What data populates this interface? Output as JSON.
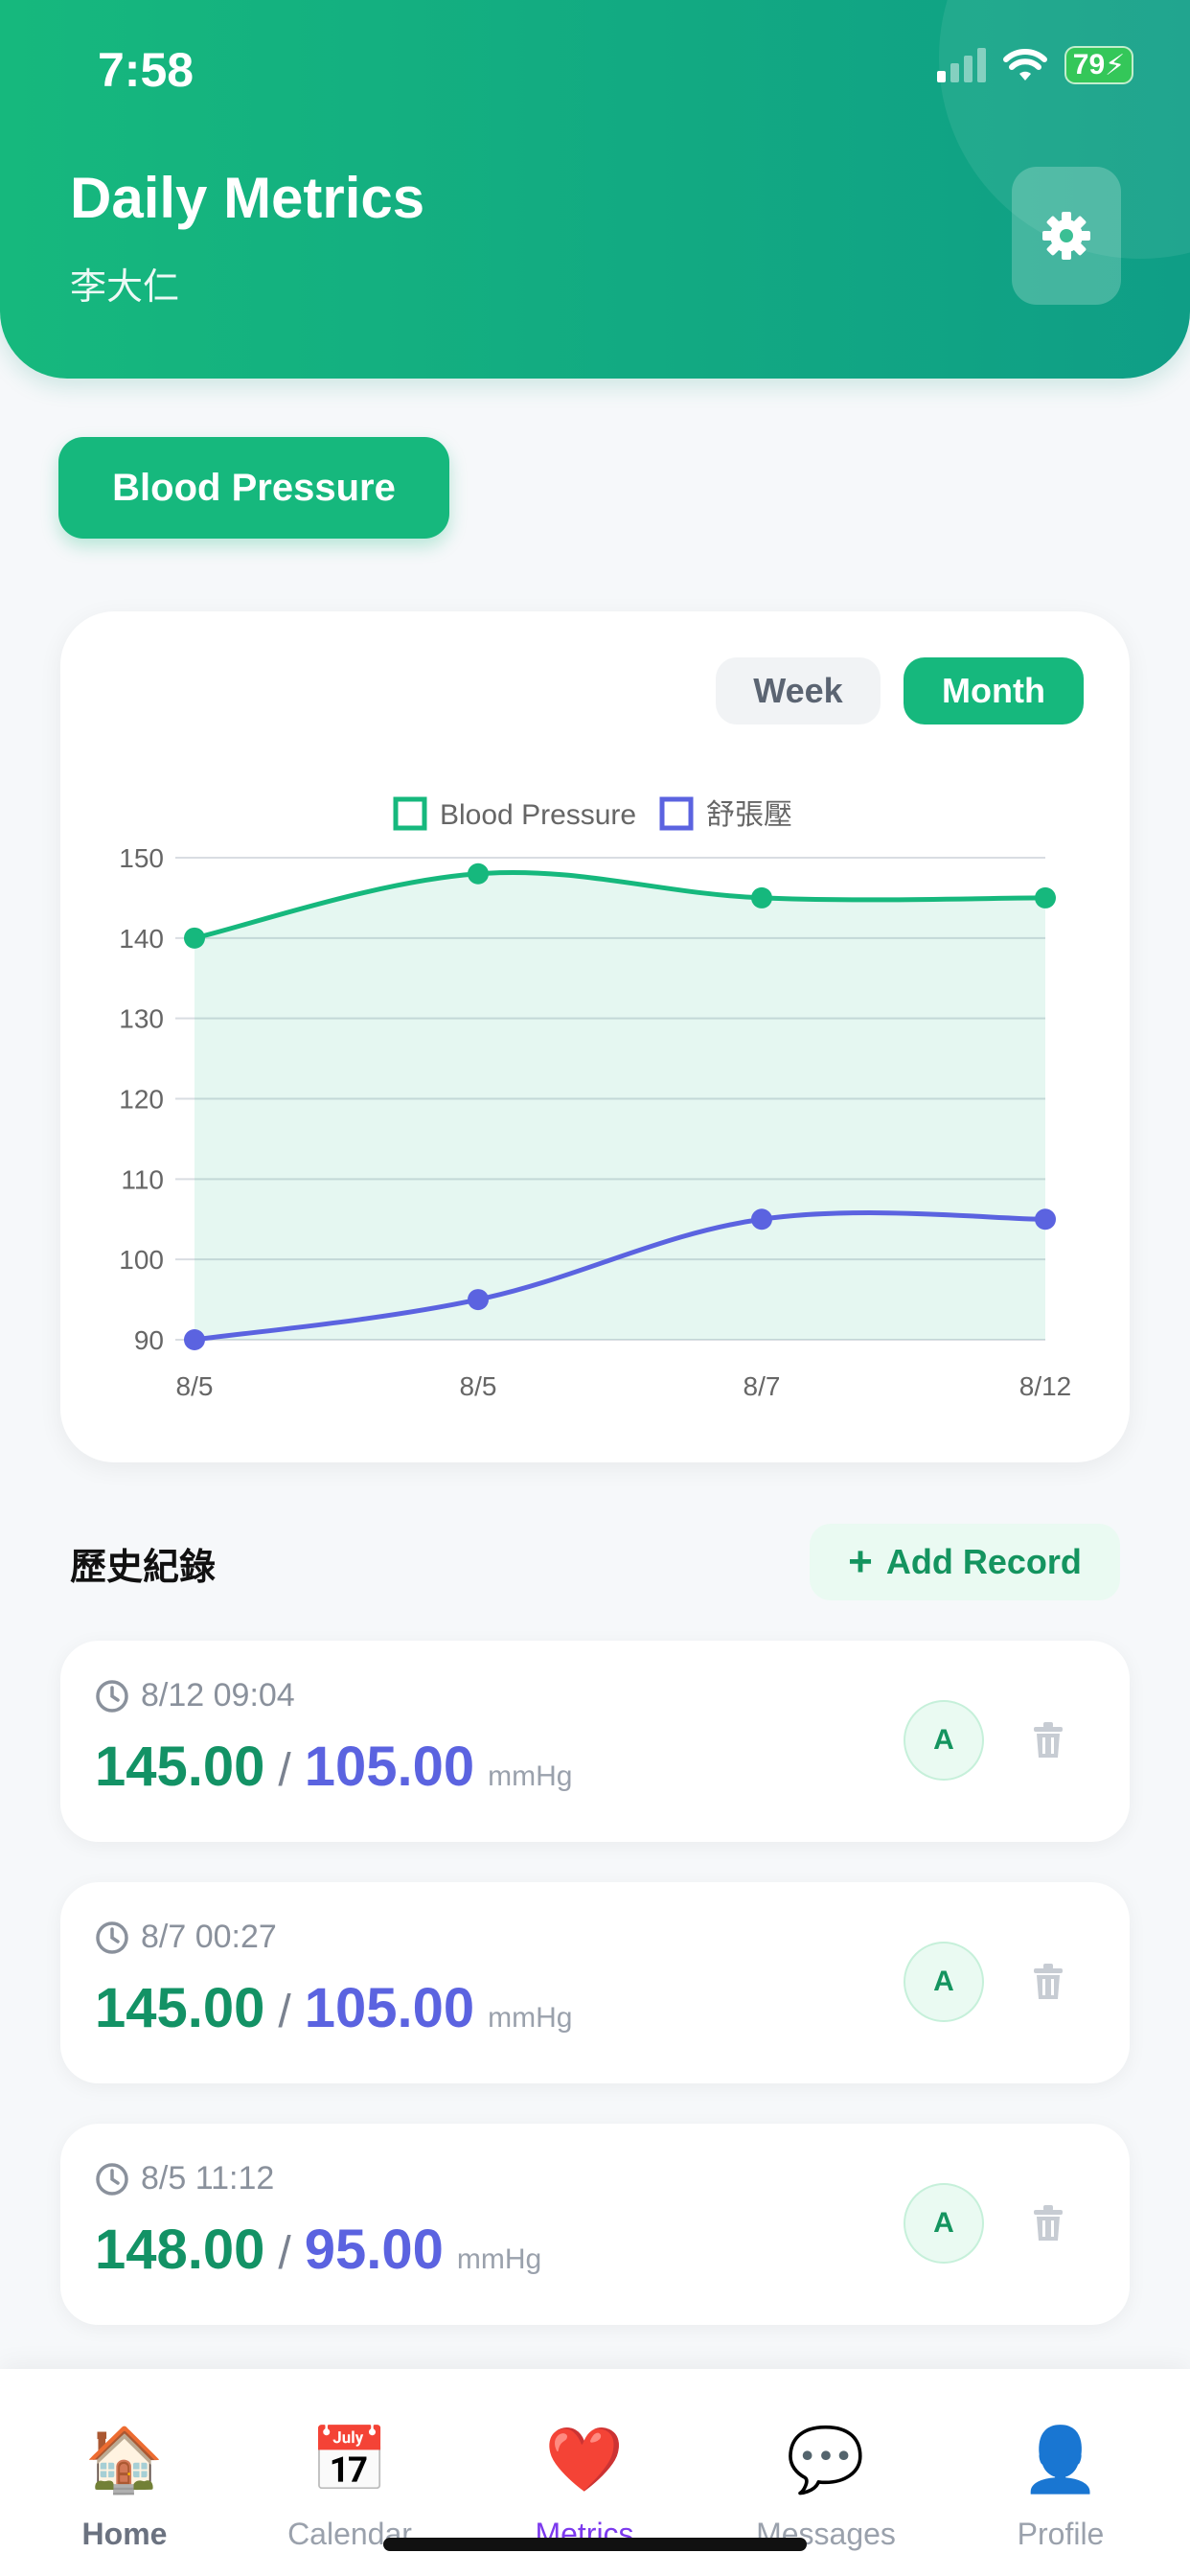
{
  "status_bar": {
    "time": "7:58",
    "battery": "79"
  },
  "header": {
    "title": "Daily Metrics",
    "user_name": "李大仁"
  },
  "metric_selector": {
    "label": "Blood Pressure"
  },
  "range_toggle": {
    "week": "Week",
    "month": "Month",
    "selected": "Month"
  },
  "chart_data": {
    "type": "line",
    "categories": [
      "8/5",
      "8/5",
      "8/7",
      "8/12"
    ],
    "series": [
      {
        "name": "Blood Pressure",
        "values": [
          140,
          148,
          145,
          145
        ],
        "color": "#16b87d",
        "fill": true
      },
      {
        "name": "舒張壓",
        "values": [
          90,
          95,
          105,
          105
        ],
        "color": "#5b63e0",
        "fill": false
      }
    ],
    "ylim": [
      90,
      150
    ],
    "yticks": [
      150,
      140,
      130,
      120,
      110,
      100,
      90
    ],
    "grid": true,
    "legend": "top-center"
  },
  "history": {
    "title": "歷史紀錄",
    "add_label": "Add Record",
    "records": [
      {
        "time": "8/12 09:04",
        "systolic": "145.00",
        "diastolic": "105.00",
        "unit": "mmHg",
        "badge": "A"
      },
      {
        "time": "8/7 00:27",
        "systolic": "145.00",
        "diastolic": "105.00",
        "unit": "mmHg",
        "badge": "A"
      },
      {
        "time": "8/5 11:12",
        "systolic": "148.00",
        "diastolic": "95.00",
        "unit": "mmHg",
        "badge": "A"
      }
    ]
  },
  "bottom_nav": {
    "items": [
      {
        "label": "Home",
        "icon": "house-icon",
        "glyph": "🏠"
      },
      {
        "label": "Calendar",
        "icon": "calendar-icon",
        "glyph": "📅"
      },
      {
        "label": "Metrics",
        "icon": "heart-icon",
        "glyph": "❤️"
      },
      {
        "label": "Messages",
        "icon": "speech-bubble-icon",
        "glyph": "💬"
      },
      {
        "label": "Profile",
        "icon": "person-icon",
        "glyph": "👤"
      }
    ],
    "active": "Metrics"
  }
}
